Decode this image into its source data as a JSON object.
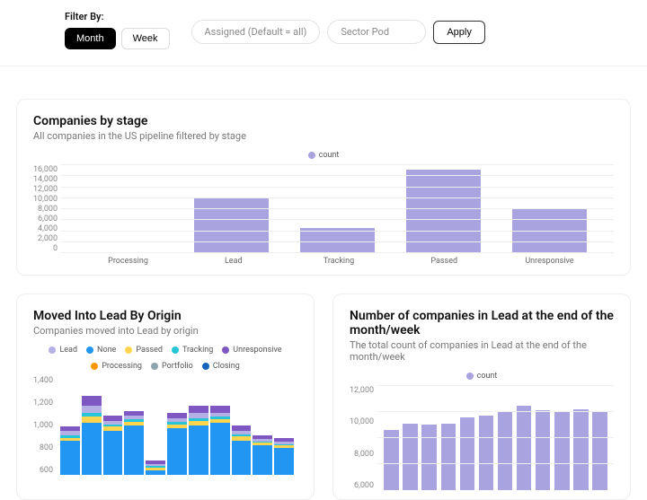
{
  "filter": {
    "label": "Filter By:",
    "month": "Month",
    "week": "Week",
    "assigned_placeholder": "Assigned (Default = all)",
    "sector_placeholder": "Sector Pod",
    "apply": "Apply"
  },
  "colors": {
    "lavender": "#a9a3e0",
    "lead": "#b4afe4",
    "none": "#2196f3",
    "passed": "#ffd54f",
    "tracking": "#26c6da",
    "unresponsive": "#7e57c2",
    "processing": "#ff9800",
    "portfolio": "#90a4ae",
    "closing": "#1565c0"
  },
  "chart1": {
    "title": "Companies by stage",
    "subtitle": "All companies in the US pipeline filtered by stage",
    "legend_count": "count"
  },
  "chart2": {
    "title": "Moved Into Lead By Origin",
    "subtitle": "Companies moved into Lead by origin",
    "legend": {
      "lead": "Lead",
      "none": "None",
      "passed": "Passed",
      "tracking": "Tracking",
      "unresponsive": "Unresponsive",
      "processing": "Processing",
      "portfolio": "Portfolio",
      "closing": "Closing"
    }
  },
  "chart3": {
    "title": "Number of companies in Lead at the end of the month/week",
    "subtitle": "The total count of companies in Lead at the end of the month/week",
    "legend_count": "count"
  },
  "chart_data": [
    {
      "id": "companies_by_stage",
      "type": "bar",
      "title": "Companies by stage",
      "categories": [
        "Processing",
        "Lead",
        "Tracking",
        "Passed",
        "Unresponsive"
      ],
      "values": [
        100,
        10200,
        4600,
        15200,
        8200
      ],
      "ylabel": "",
      "xlabel": "",
      "ylim": [
        0,
        16000
      ],
      "yticks": [
        0,
        2000,
        4000,
        6000,
        8000,
        10000,
        12000,
        14000,
        16000
      ],
      "series_name": "count"
    },
    {
      "id": "moved_into_lead_by_origin",
      "type": "bar_stacked",
      "title": "Moved Into Lead By Origin",
      "ylim": [
        600,
        1400
      ],
      "yticks": [
        600,
        800,
        1000,
        1200,
        1400
      ],
      "series_order": [
        "None",
        "Passed",
        "Tracking",
        "Lead",
        "Unresponsive",
        "Processing",
        "Portfolio",
        "Closing"
      ],
      "points": [
        {
          "None": 880,
          "Passed": 20,
          "Tracking": 20,
          "Lead": 40,
          "Unresponsive": 30
        },
        {
          "None": 1020,
          "Passed": 50,
          "Tracking": 30,
          "Lead": 60,
          "Unresponsive": 80
        },
        {
          "None": 960,
          "Passed": 30,
          "Tracking": 20,
          "Lead": 30,
          "Unresponsive": 40
        },
        {
          "None": 1000,
          "Passed": 30,
          "Tracking": 20,
          "Lead": 30,
          "Unresponsive": 40
        },
        {
          "None": 640,
          "Passed": 20,
          "Tracking": 10,
          "Lead": 20,
          "Unresponsive": 30
        },
        {
          "None": 980,
          "Passed": 30,
          "Tracking": 20,
          "Lead": 30,
          "Unresponsive": 40
        },
        {
          "None": 1000,
          "Passed": 40,
          "Tracking": 20,
          "Lead": 40,
          "Unresponsive": 60
        },
        {
          "None": 1020,
          "Passed": 30,
          "Tracking": 20,
          "Lead": 30,
          "Unresponsive": 60
        },
        {
          "None": 880,
          "Passed": 30,
          "Tracking": 20,
          "Lead": 30,
          "Unresponsive": 40
        },
        {
          "None": 840,
          "Passed": 20,
          "Tracking": 10,
          "Lead": 20,
          "Unresponsive": 30
        },
        {
          "None": 820,
          "Passed": 20,
          "Tracking": 10,
          "Lead": 20,
          "Unresponsive": 30
        }
      ]
    },
    {
      "id": "lead_end_of_period",
      "type": "bar",
      "title": "Number of companies in Lead at the end of the month/week",
      "series_name": "count",
      "ylim": [
        4000,
        12000
      ],
      "yticks": [
        6000,
        8000,
        10000,
        12000
      ],
      "values": [
        8600,
        9100,
        9050,
        9100,
        9600,
        9700,
        10100,
        10500,
        10150,
        10000,
        10200,
        10100
      ]
    }
  ]
}
